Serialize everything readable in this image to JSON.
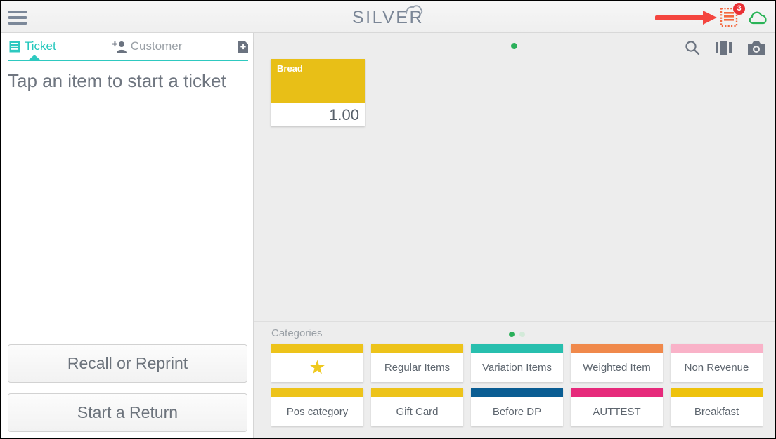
{
  "app": {
    "logo_text": "SILVER",
    "menu_icon": "hamburger-menu-icon",
    "cloud_icon": "cloud-icon",
    "receipt_icon": "receipt-icon",
    "receipt_badge_count": "3",
    "annotation_arrow": "red-arrow-pointing-right",
    "colors": {
      "teal": "#2ec9c0",
      "green": "#2bb05a",
      "gold": "#e8bf17",
      "red": "#f4453f",
      "badge_red": "#ea2f34",
      "logo_gray": "#7b8696"
    }
  },
  "sidebar": {
    "tabs": [
      {
        "label": "Ticket",
        "icon": "ticket-list-icon",
        "active": true
      },
      {
        "label": "Customer",
        "icon": "add-person-icon",
        "active": false
      },
      {
        "label": "Info",
        "icon": "file-add-icon",
        "active": false
      }
    ],
    "empty_message": "Tap an item to start a ticket",
    "buttons": [
      {
        "label": "Recall or Reprint"
      },
      {
        "label": "Start a Return"
      }
    ]
  },
  "main": {
    "icons": [
      {
        "name": "search-icon"
      },
      {
        "name": "grid-layout-icon"
      },
      {
        "name": "camera-icon"
      }
    ],
    "page_indicator": {
      "total": 1,
      "active_index": 0
    },
    "items": [
      {
        "name": "Bread",
        "price": "1.00",
        "color": "#e8bf17"
      }
    ],
    "categories": {
      "header": "Categories",
      "page_dots": [
        {
          "active": true
        },
        {
          "active": false
        }
      ],
      "tiles": [
        {
          "label": "",
          "icon": "star-icon",
          "color": "#edc31a"
        },
        {
          "label": "Regular Items",
          "icon": "",
          "color": "#edc31a"
        },
        {
          "label": "Variation Items",
          "icon": "",
          "color": "#28bfae"
        },
        {
          "label": "Weighted Item",
          "icon": "",
          "color": "#f0894b"
        },
        {
          "label": "Non Revenue",
          "icon": "",
          "color": "#f9b2c8"
        },
        {
          "label": "Pos category",
          "icon": "",
          "color": "#edc31a"
        },
        {
          "label": "Gift Card",
          "icon": "",
          "color": "#edc31a"
        },
        {
          "label": "Before DP",
          "icon": "",
          "color": "#0a5d93"
        },
        {
          "label": "AUTTEST",
          "icon": "",
          "color": "#e62a7b"
        },
        {
          "label": "Breakfast",
          "icon": "",
          "color": "#eec20c"
        }
      ]
    }
  }
}
